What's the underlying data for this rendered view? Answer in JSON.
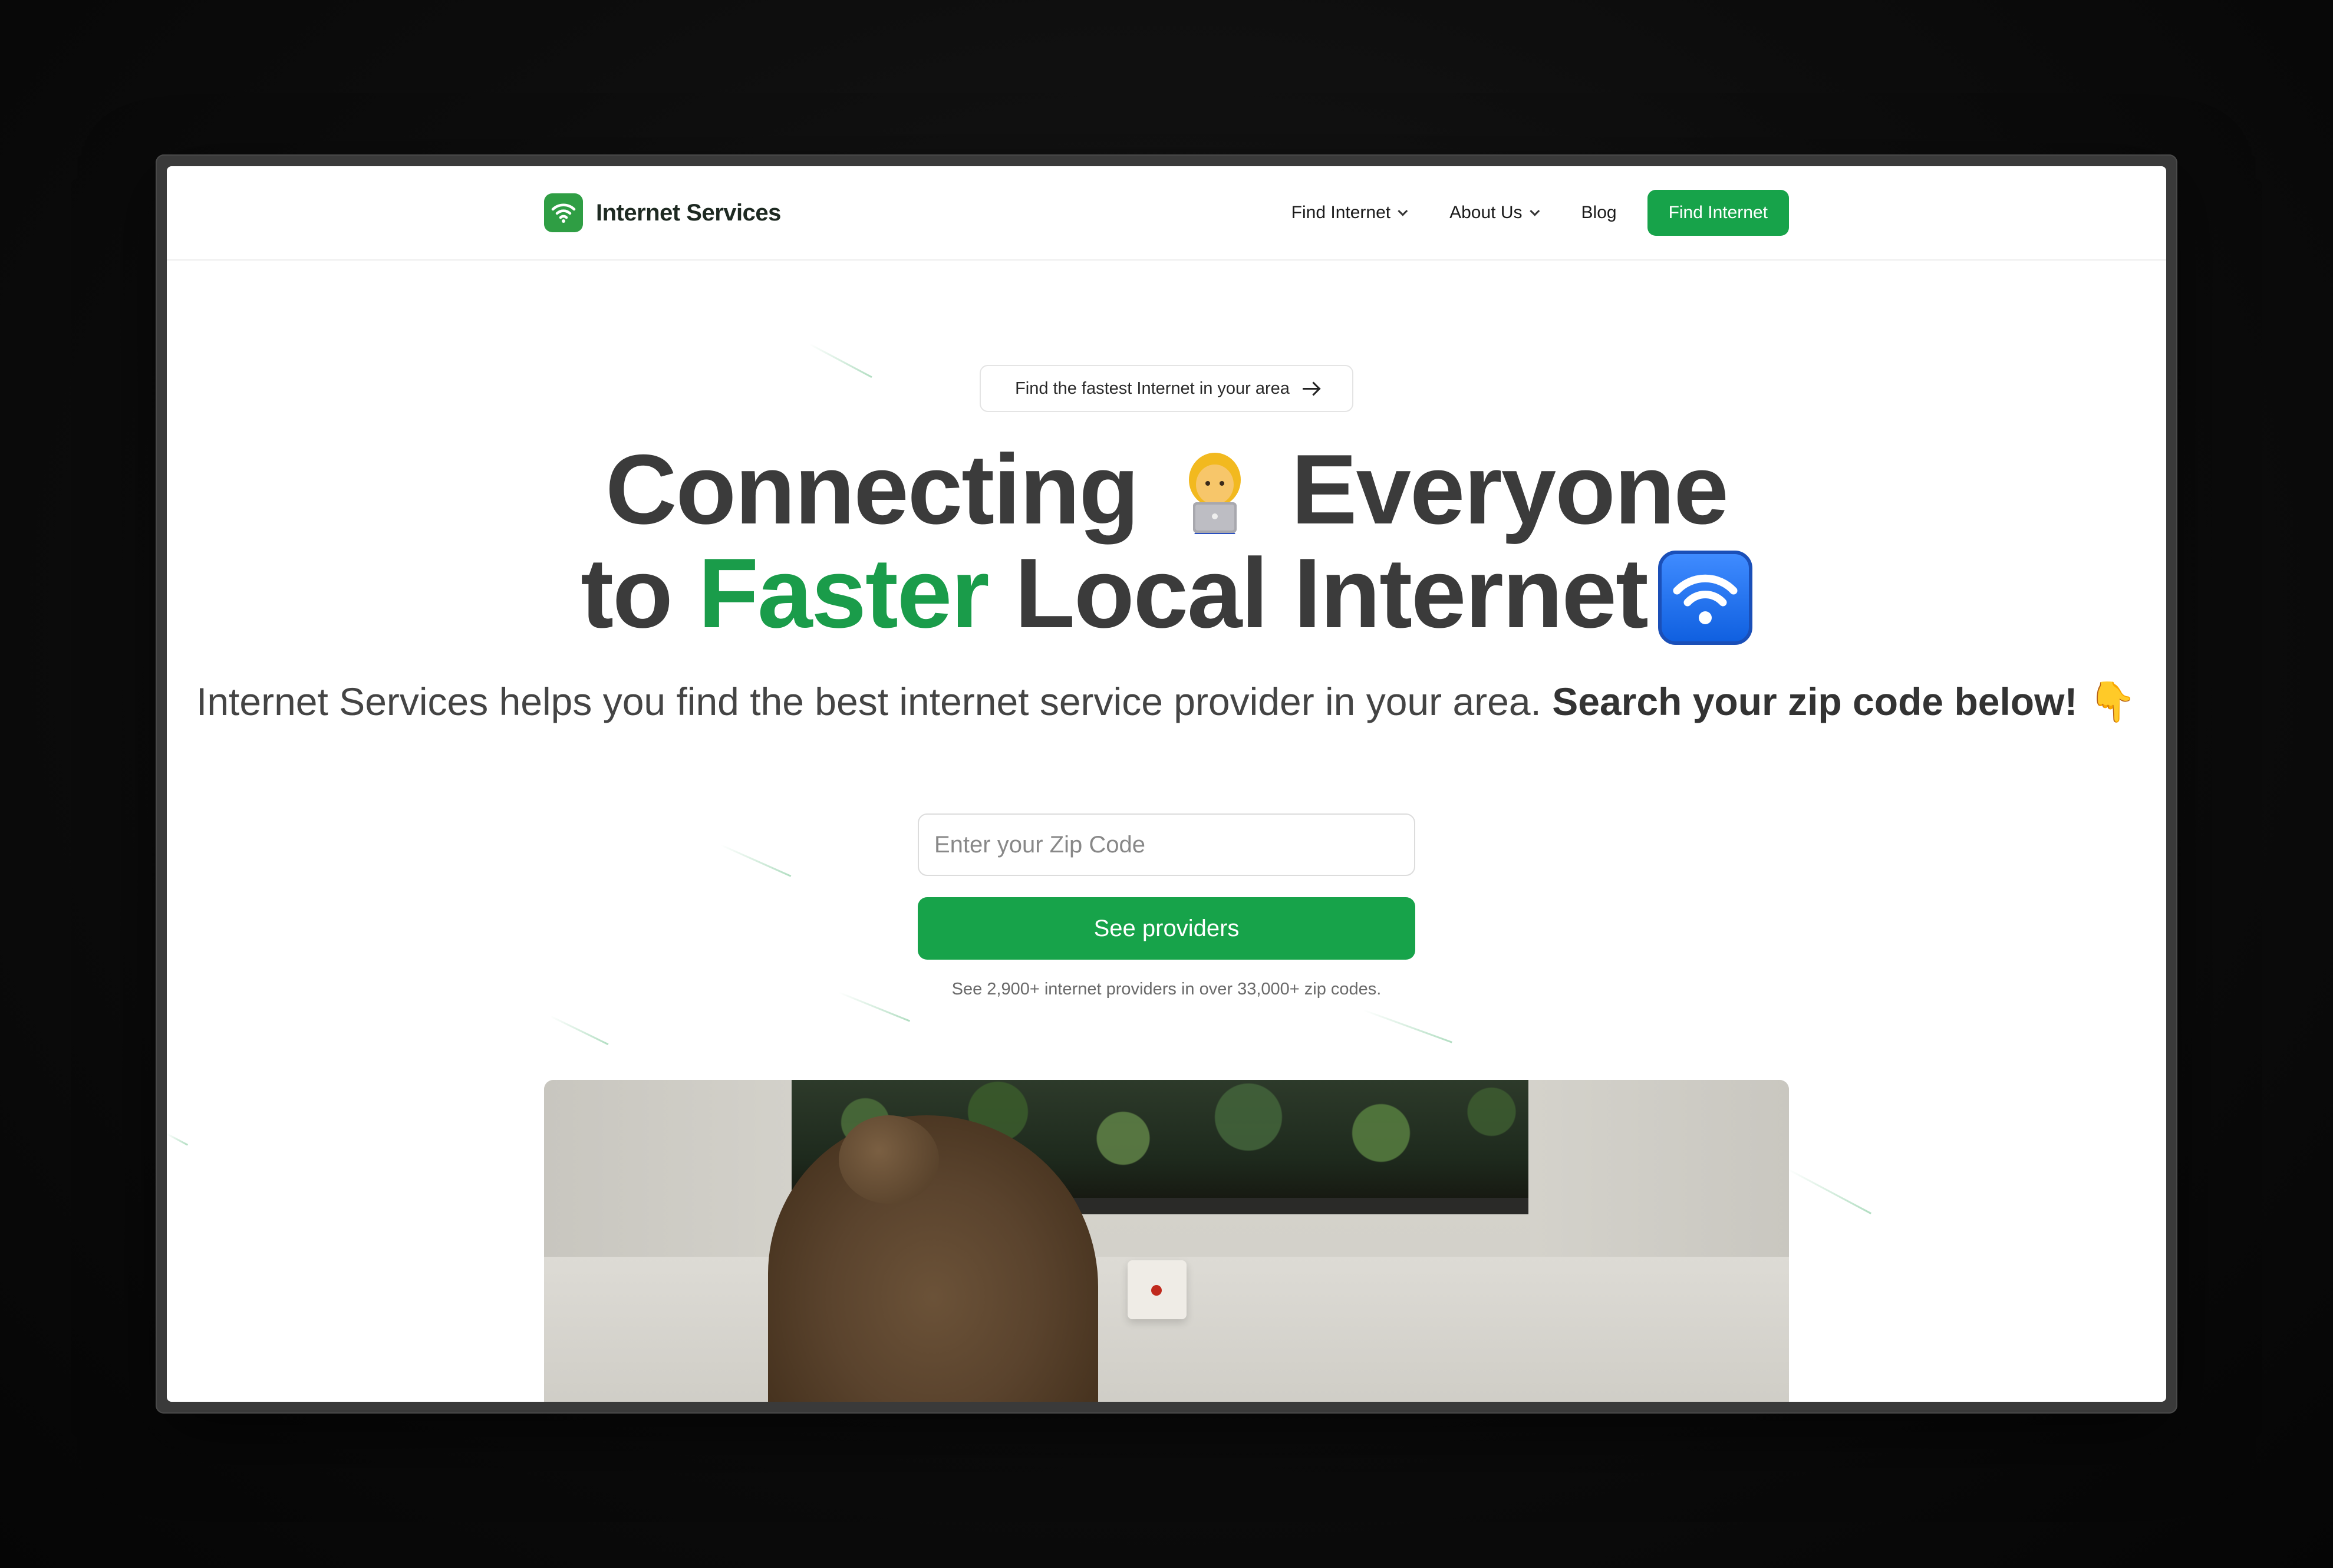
{
  "brand": {
    "name": "Internet Services",
    "logo_icon": "wifi-icon",
    "accent": "#17a34a"
  },
  "nav": {
    "items": [
      {
        "label": "Find Internet",
        "has_dropdown": true
      },
      {
        "label": "About Us",
        "has_dropdown": true
      },
      {
        "label": "Blog",
        "has_dropdown": false
      }
    ],
    "cta_label": "Find Internet"
  },
  "hero": {
    "pill_label": "Find the fastest Internet in your area",
    "pill_icon": "arrow-right-icon",
    "headline_line1_a": "Connecting",
    "headline_line1_b": "Everyone",
    "headline_line2_a": "to",
    "headline_line2_green": "Faster",
    "headline_line2_b": "Local Internet",
    "emoji_person": "person-with-laptop-emoji",
    "emoji_wifi": "wifi-emoji",
    "subtitle_plain": "Internet Services helps you find the best internet service provider in your area.",
    "subtitle_bold": "Search your zip code below!",
    "subtitle_emoji": "👇"
  },
  "search": {
    "placeholder": "Enter your Zip Code",
    "value": "",
    "button_label": "See providers",
    "note": "See 2,900+ internet providers in over 33,000+ zip codes."
  }
}
